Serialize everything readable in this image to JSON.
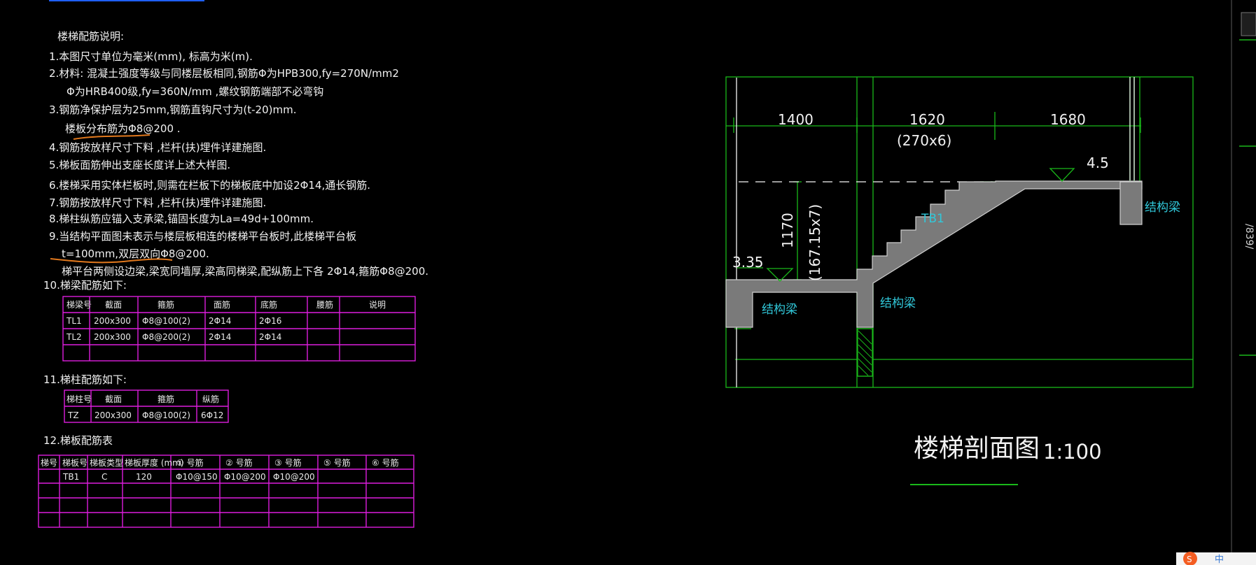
{
  "notes": {
    "heading": "楼梯配筋说明:",
    "items": [
      "1.本图尺寸单位为毫米(mm), 标高为米(m).",
      "2.材料: 混凝土强度等级与同楼层板相同,钢筋Φ为HPB300,fy=270N/mm2",
      "Φ为HRB400级,fy=360N/mm ,螺纹钢筋端部不必弯钩",
      "3.钢筋净保护层为25mm,钢筋直钩尺寸为(t-20)mm.",
      "楼板分布筋为Φ8@200 .",
      "4.钢筋按放样尺寸下料 ,栏杆(扶)埋件详建施图.",
      "5.梯板面筋伸出支座长度详上述大样图.",
      "6.楼梯采用实体栏板时,则需在栏板下的梯板底中加设2Φ14,通长钢筋.",
      "7.钢筋按放样尺寸下料 ,栏杆(扶)埋件详建施图.",
      "8.梯柱纵筋应锚入支承梁,锚固长度为La=49d+100mm.",
      "9.当结构平面图未表示与楼层板相连的楼梯平台板时,此楼梯平台板",
      "t=100mm,双层双向Φ8@200.",
      "梯平台两侧设边梁,梁宽同墙厚,梁高同梯梁,配纵筋上下各 2Φ14,箍筋Φ8@200."
    ]
  },
  "beam_table": {
    "heading": "10.梯梁配筋如下:",
    "headers": [
      "梯梁号",
      "截面",
      "箍筋",
      "面筋",
      "底筋",
      "腰筋",
      "说明"
    ],
    "rows": [
      [
        "TL1",
        "200x300",
        "Φ8@100(2)",
        "2Φ14",
        "2Φ16",
        "",
        ""
      ],
      [
        "TL2",
        "200x300",
        "Φ8@200(2)",
        "2Φ14",
        "2Φ14",
        "",
        ""
      ],
      [
        "",
        "",
        "",
        "",
        "",
        "",
        ""
      ]
    ]
  },
  "column_table": {
    "heading": "11.梯柱配筋如下:",
    "headers": [
      "梯柱号",
      "截面",
      "箍筋",
      "纵筋"
    ],
    "rows": [
      [
        "TZ",
        "200x300",
        "Φ8@100(2)",
        "6Φ12"
      ]
    ]
  },
  "slab_table": {
    "heading": "12.梯板配筋表",
    "headers": [
      "梯号",
      "梯板号",
      "梯板类型",
      "梯板厚度 (mm)",
      "① 号筋",
      "② 号筋",
      "③ 号筋",
      "⑤ 号筋",
      "⑥ 号筋"
    ],
    "rows": [
      [
        "",
        "TB1",
        "C",
        "120",
        "Φ10@150",
        "Φ10@200",
        "Φ10@200",
        "",
        ""
      ],
      [
        "",
        "",
        "",
        "",
        "",
        "",
        "",
        "",
        ""
      ],
      [
        "",
        "",
        "",
        "",
        "",
        "",
        "",
        "",
        ""
      ],
      [
        "",
        "",
        "",
        "",
        "",
        "",
        "",
        "",
        ""
      ]
    ]
  },
  "section": {
    "dims_top": [
      "1400",
      "1620",
      "1680"
    ],
    "step_spec": "(270x6)",
    "elevation_upper": "4.5",
    "elevation_lower": "3.35",
    "height": "1170",
    "height_spec": "(167.15x7)",
    "slab_label": "TB1",
    "beam_label": "结构梁",
    "title": "楼梯剖面图",
    "scale": "1:100"
  },
  "sidebar_text": "/839/",
  "ime": {
    "logo": "S",
    "text": "中"
  },
  "colors": {
    "background": "#000000",
    "table_lines": "#dd1ddd",
    "section_lines": "#1ab81a",
    "labels": "#31c8da",
    "markup": "#e1781d"
  }
}
